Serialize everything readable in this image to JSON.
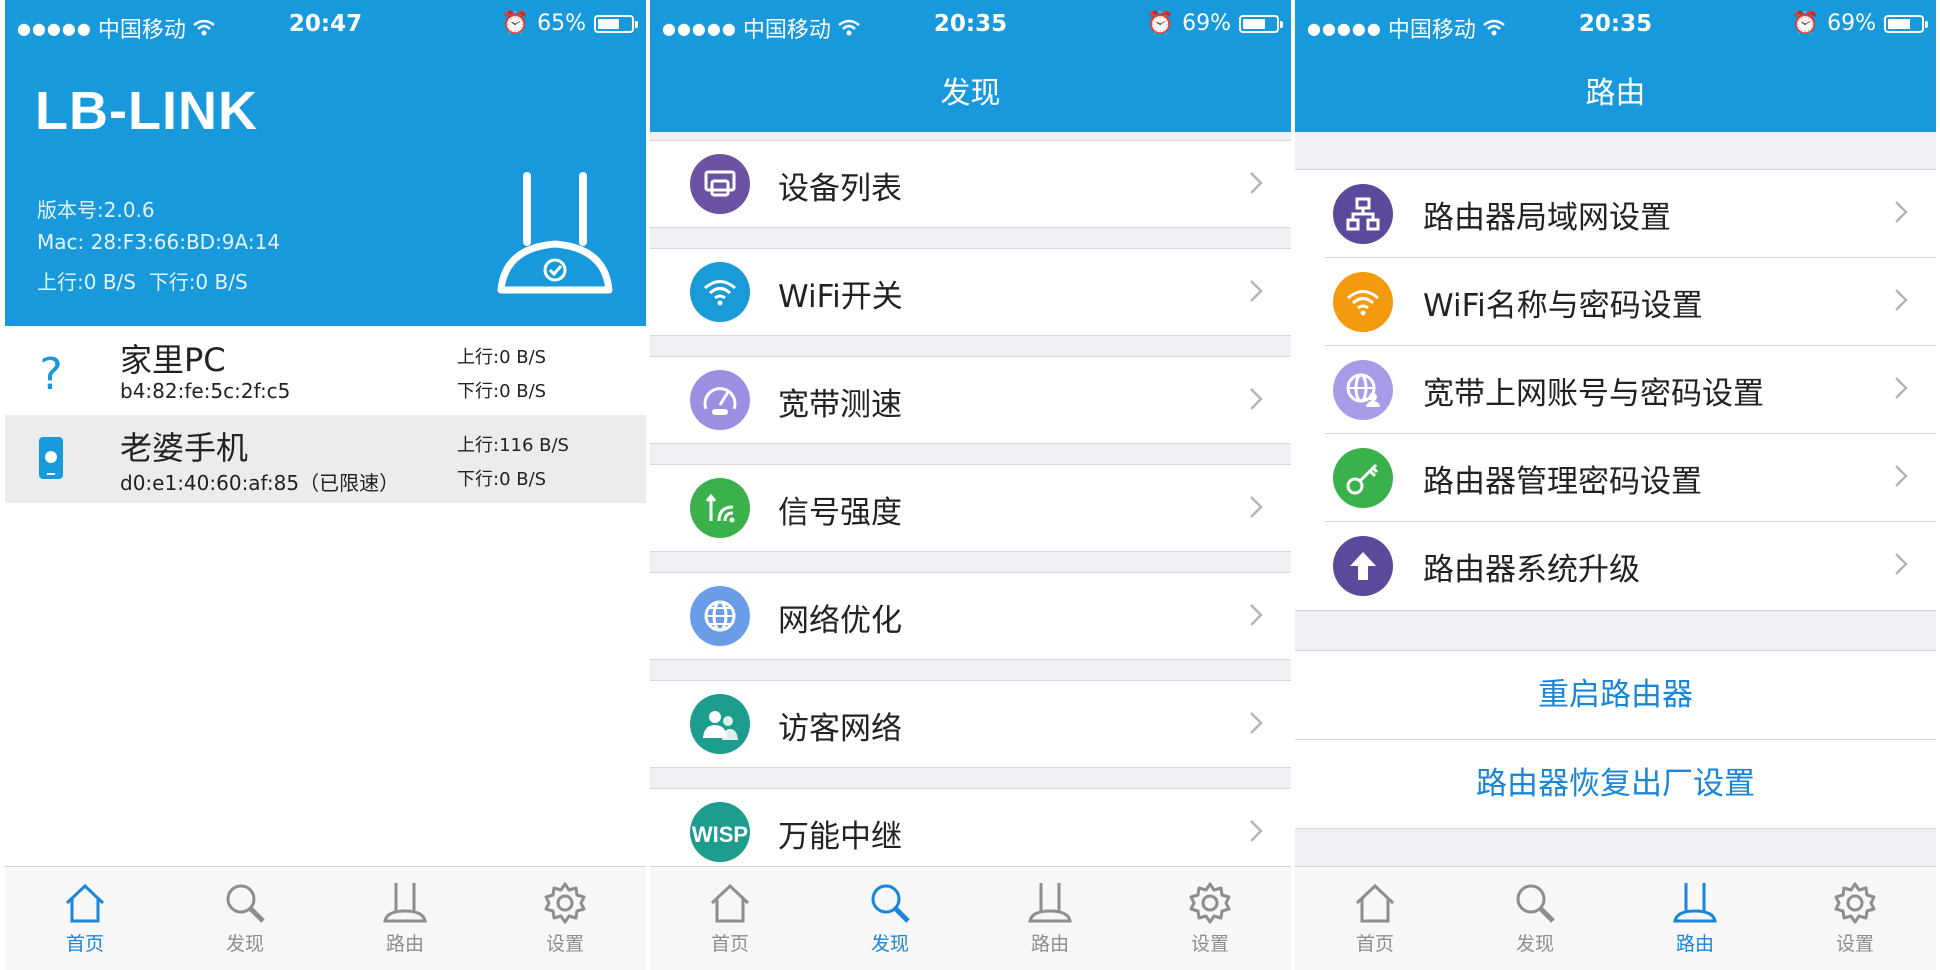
{
  "screen1": {
    "status": {
      "carrier": "中国移动",
      "time": "20:47",
      "battery": "65%",
      "battery_level": 0.65
    },
    "logo": "LB-LINK",
    "version": "版本号:2.0.6",
    "mac": "Mac: 28:F3:66:BD:9A:14",
    "speed": "上行:0 B/S  下行:0 B/S",
    "devices": [
      {
        "name": "家里PC",
        "mac": "b4:82:fe:5c:2f:c5",
        "up": "上行:0 B/S",
        "down": "下行:0 B/S",
        "icon": "question-icon"
      },
      {
        "name": "老婆手机",
        "mac": "d0:e1:40:60:af:85（已限速）",
        "up": "上行:116 B/S",
        "down": "下行:0 B/S",
        "icon": "apple-phone-icon"
      }
    ],
    "tabs": [
      "首页",
      "发现",
      "路由",
      "设置"
    ],
    "active_tab": 0
  },
  "screen2": {
    "status": {
      "carrier": "中国移动",
      "time": "20:35",
      "battery": "69%",
      "battery_level": 0.69
    },
    "title": "发现",
    "items": [
      {
        "label": "设备列表",
        "icon": "device-list-icon",
        "color": "#6b52a3"
      },
      {
        "label": "WiFi开关",
        "icon": "wifi-icon",
        "color": "#1a9ad6"
      },
      {
        "label": "宽带测速",
        "icon": "speedometer-icon",
        "color": "#9a8fe0"
      },
      {
        "label": "信号强度",
        "icon": "signal-icon",
        "color": "#3ab14a"
      },
      {
        "label": "网络优化",
        "icon": "globe-icon",
        "color": "#6a9de8"
      },
      {
        "label": "访客网络",
        "icon": "guests-icon",
        "color": "#1e9c8e"
      },
      {
        "label": "万能中继",
        "icon": "wisp-icon",
        "color": "#1e9c8e",
        "badge": "WISP"
      }
    ],
    "tabs": [
      "首页",
      "发现",
      "路由",
      "设置"
    ],
    "active_tab": 1
  },
  "screen3": {
    "status": {
      "carrier": "中国移动",
      "time": "20:35",
      "battery": "69%",
      "battery_level": 0.69
    },
    "title": "路由",
    "items": [
      {
        "label": "路由器局域网设置",
        "icon": "lan-icon",
        "color": "#5b4a9c"
      },
      {
        "label": "WiFi名称与密码设置",
        "icon": "wifi-icon",
        "color": "#f39a0f"
      },
      {
        "label": "宽带上网账号与密码设置",
        "icon": "globe-user-icon",
        "color": "#a79ce8"
      },
      {
        "label": "路由器管理密码设置",
        "icon": "key-icon",
        "color": "#3ab14a"
      },
      {
        "label": "路由器系统升级",
        "icon": "upgrade-icon",
        "color": "#5b4a9c"
      }
    ],
    "actions": [
      "重启路由器",
      "路由器恢复出厂设置"
    ],
    "tabs": [
      "首页",
      "发现",
      "路由",
      "设置"
    ],
    "active_tab": 2
  }
}
